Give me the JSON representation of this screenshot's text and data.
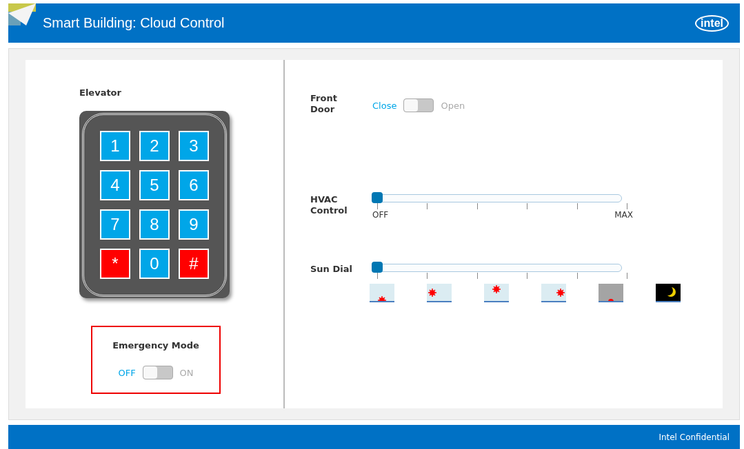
{
  "header": {
    "title": "Smart Building: Cloud Control",
    "logo": "intel"
  },
  "elevator": {
    "title": "Elevator",
    "keys": [
      {
        "label": "1",
        "kind": "digit"
      },
      {
        "label": "2",
        "kind": "digit"
      },
      {
        "label": "3",
        "kind": "digit"
      },
      {
        "label": "4",
        "kind": "digit"
      },
      {
        "label": "5",
        "kind": "digit"
      },
      {
        "label": "6",
        "kind": "digit"
      },
      {
        "label": "7",
        "kind": "digit"
      },
      {
        "label": "8",
        "kind": "digit"
      },
      {
        "label": "9",
        "kind": "digit"
      },
      {
        "label": "*",
        "kind": "symbol"
      },
      {
        "label": "0",
        "kind": "digit"
      },
      {
        "label": "#",
        "kind": "symbol"
      }
    ]
  },
  "emergency": {
    "title": "Emergency Mode",
    "off_label": "OFF",
    "on_label": "ON",
    "on": false
  },
  "front_door": {
    "label": "Front Door",
    "off_label": "Close",
    "on_label": "Open",
    "on": false
  },
  "hvac": {
    "label": "HVAC Control",
    "level": 0,
    "min_label": "OFF",
    "max_label": "MAX"
  },
  "sun_dial": {
    "label": "Sun Dial",
    "level": 0,
    "icons": [
      {
        "kind": "sunrise"
      },
      {
        "kind": "morning"
      },
      {
        "kind": "noon"
      },
      {
        "kind": "afternoon"
      },
      {
        "kind": "sunset"
      },
      {
        "kind": "night"
      }
    ]
  },
  "footer": {
    "text": "Intel Confidential"
  }
}
